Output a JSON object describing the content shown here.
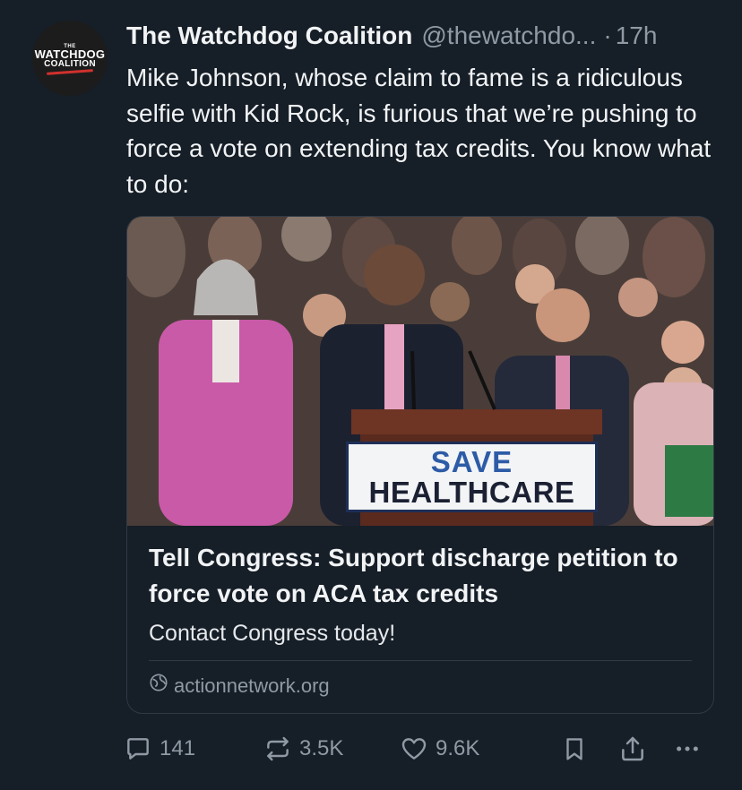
{
  "account": {
    "avatar_text_top": "THE",
    "avatar_text_main": "WATCHDOG",
    "avatar_text_sub": "COALITION",
    "display_name": "The Watchdog Coalition",
    "handle": "@thewatchdo...",
    "separator": "·",
    "time_ago": "17h"
  },
  "post": {
    "text": "Mike Johnson, whose claim to fame is a ridiculous selfie with Kid Rock, is furious that we’re pushing to force a vote on extending tax credits. You know what to do:"
  },
  "link_card": {
    "image_sign_line1": "SAVE",
    "image_sign_line2": "HEALTHCARE",
    "title": "Tell Congress: Support discharge petition to force vote on ACA tax credits",
    "description": "Contact Congress today!",
    "domain": "actionnetwork.org",
    "domain_icon": "globe-icon"
  },
  "actions": {
    "replies": "141",
    "reposts": "3.5K",
    "likes": "9.6K",
    "icons": [
      "reply-icon",
      "repost-icon",
      "like-icon",
      "bookmark-icon",
      "share-icon",
      "more-icon"
    ]
  },
  "colors": {
    "background": "#161e27",
    "primary_text": "#f1f3f5",
    "secondary_text": "#8f9aa5",
    "border": "#2f3a45"
  }
}
